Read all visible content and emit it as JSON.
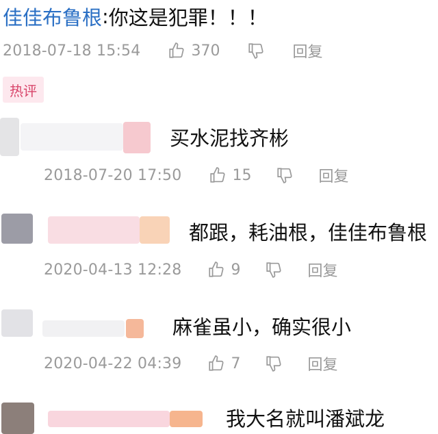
{
  "top_comment": {
    "user": "佳佳布鲁根",
    "separator": ":",
    "text": "你这是犯罪！！！",
    "time": "2018-07-18 15:54",
    "likes": "370",
    "reply_label": "回复"
  },
  "hot_badge": "热评",
  "replies": [
    {
      "text": "买水泥找齐彬",
      "time": "2018-07-20 17:50",
      "likes": "15",
      "reply_label": "回复"
    },
    {
      "text": "都跟，耗油根，佳佳布鲁根",
      "time": "2020-04-13 12:28",
      "likes": "9",
      "reply_label": "回复"
    },
    {
      "text": "麻雀虽小，确实很小",
      "time": "2020-04-22 04:39",
      "likes": "7",
      "reply_label": "回复"
    },
    {
      "text": "我大名就叫潘斌龙"
    }
  ],
  "colors": {
    "username": "#2a6fc4",
    "meta_gray": "#9a9a9a",
    "badge_bg": "#fde8ee",
    "badge_text": "#d8456a"
  },
  "icons": {
    "like": "thumbs-up-icon",
    "dislike": "thumbs-down-icon"
  }
}
